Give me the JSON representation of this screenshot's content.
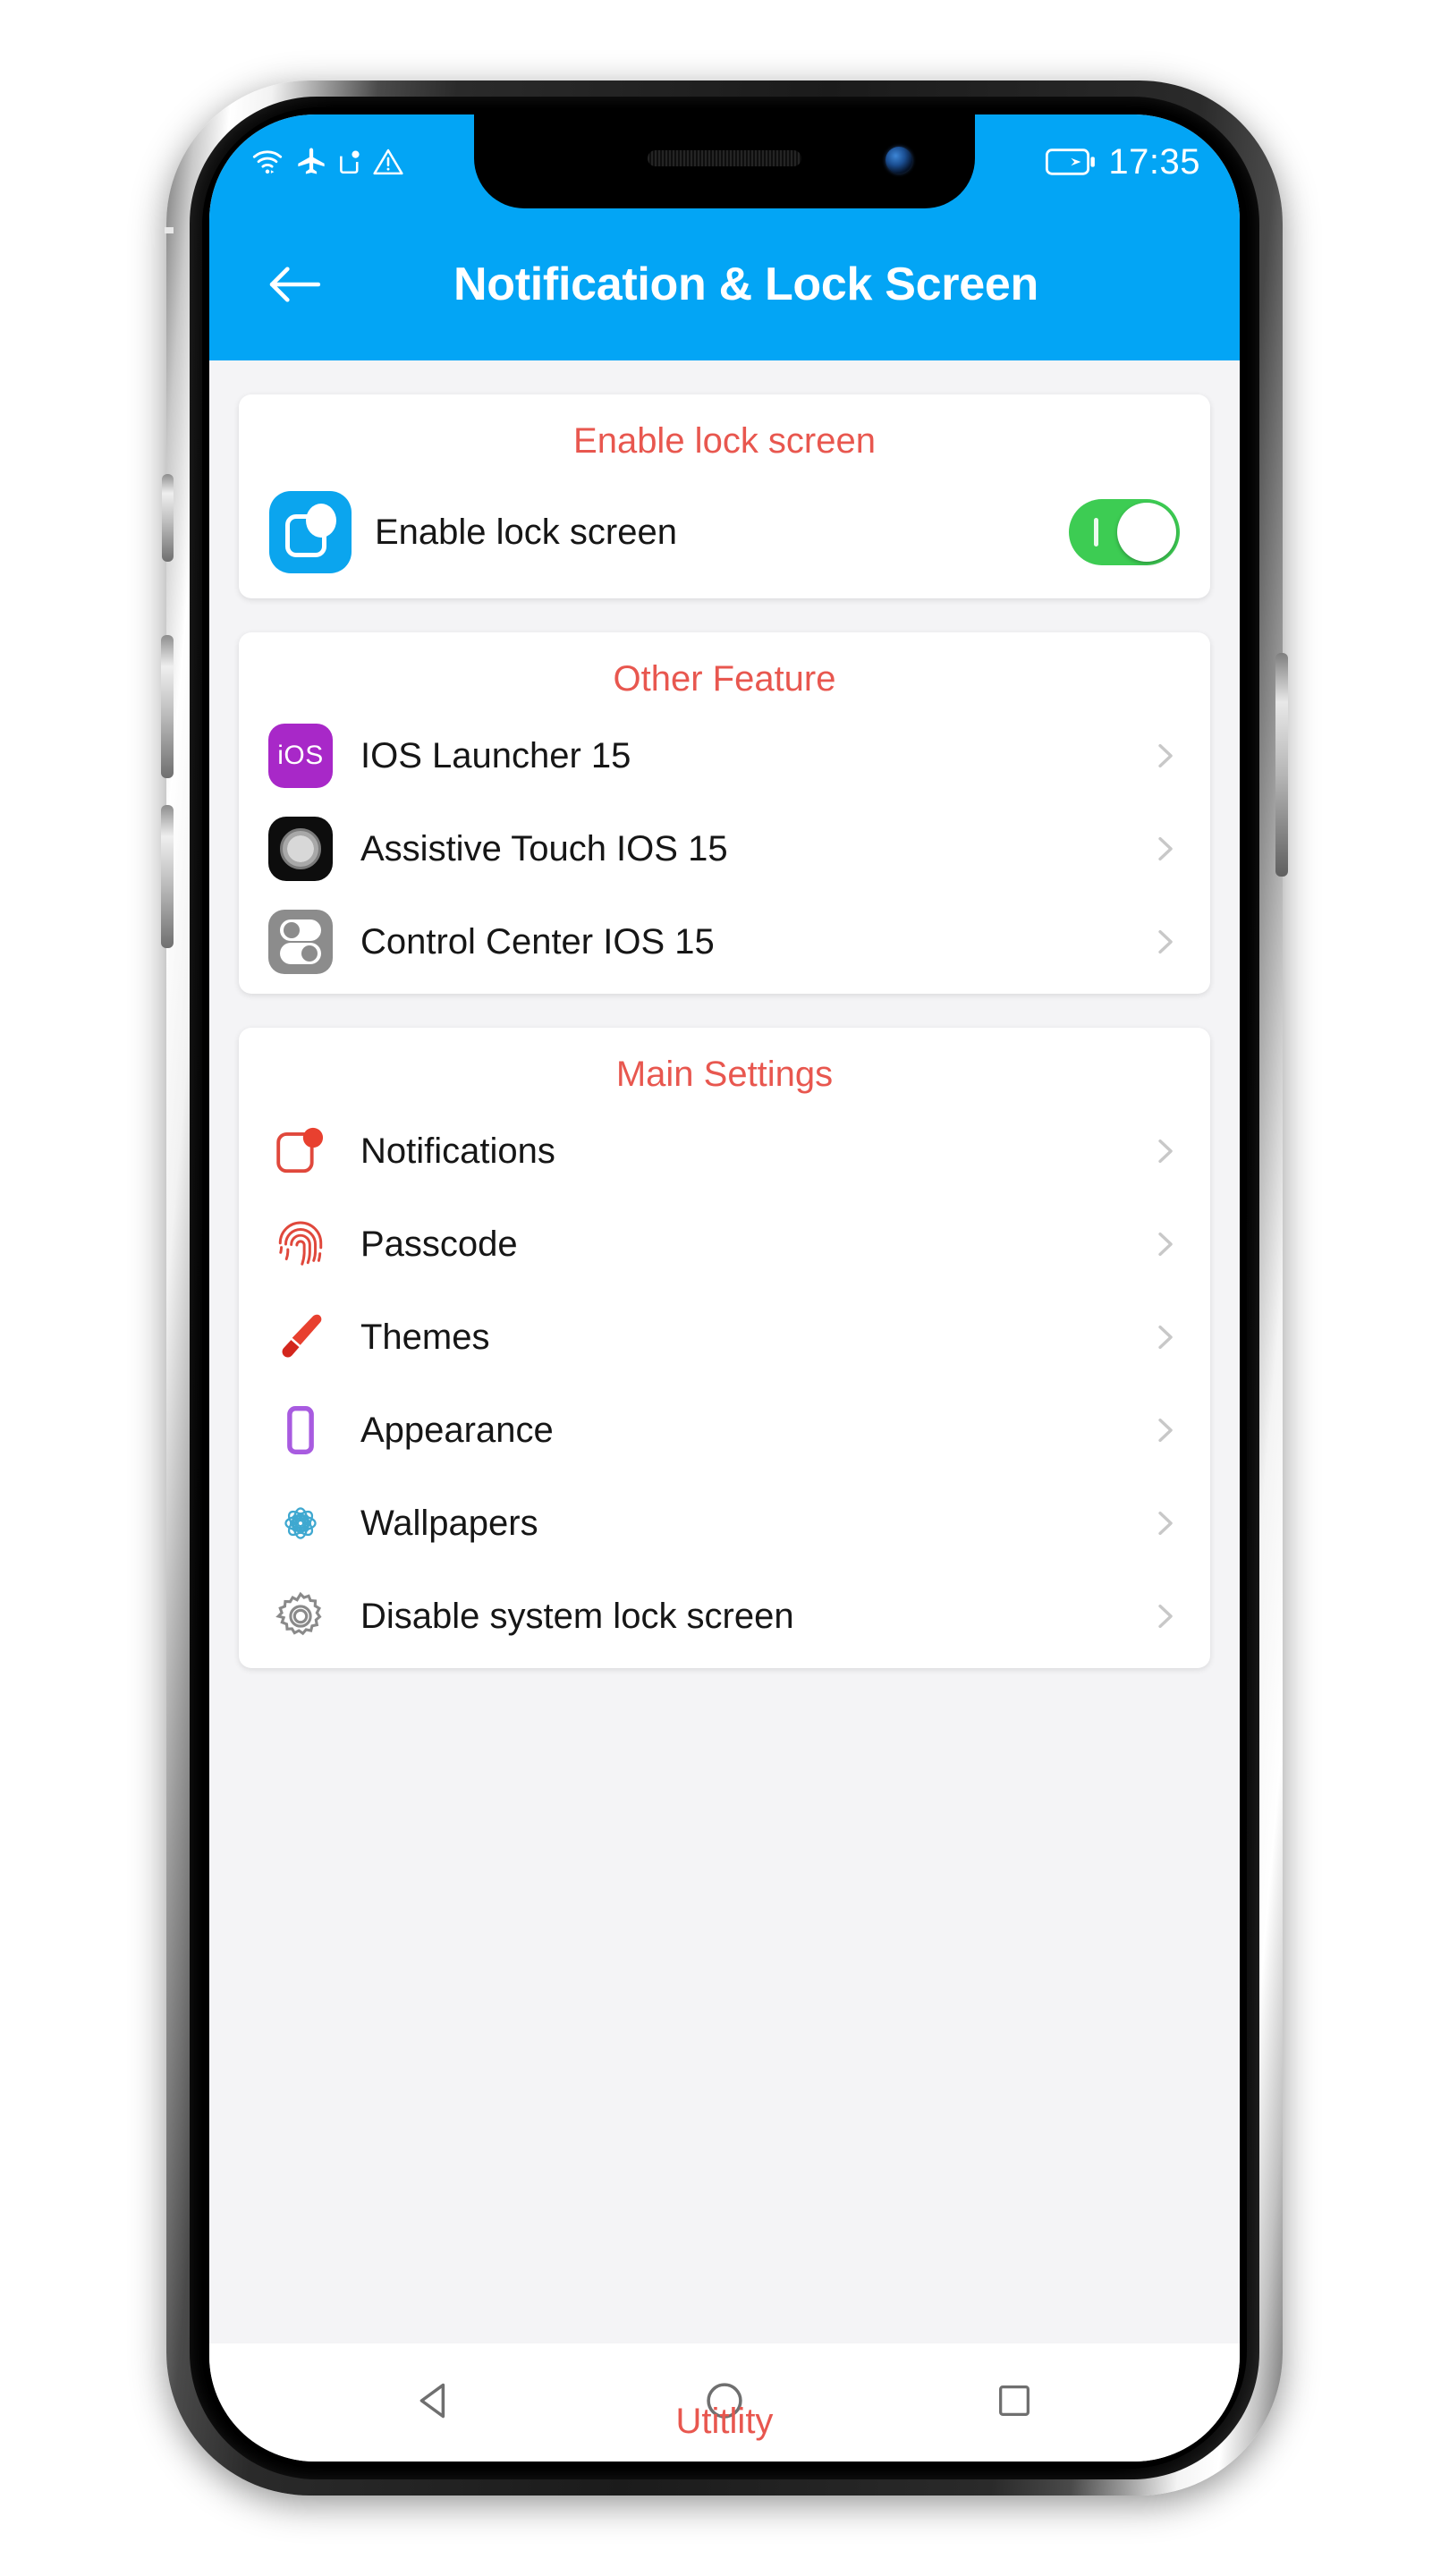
{
  "statusbar": {
    "time": "17:35",
    "icons_left": [
      "wifi-icon",
      "airplane-mode-icon",
      "sim-icon",
      "warning-triangle-icon"
    ],
    "battery": "battery-charging-icon"
  },
  "appbar": {
    "back": "back-arrow-icon",
    "title": "Notification & Lock Screen"
  },
  "colors": {
    "accent_blue": "#03A5F5",
    "section_red": "#E8574F",
    "toggle_green": "#3DCC53",
    "chevron_gray": "#C8C8C8",
    "page_bg": "#F4F4F6",
    "card_bg": "#FFFFFF"
  },
  "cards": [
    {
      "title": "Enable lock screen",
      "rows": [
        {
          "label": "Enable lock screen",
          "icon": "lock-screen-app-icon",
          "control": "toggle",
          "toggle_on": true
        }
      ]
    },
    {
      "title": "Other Feature",
      "rows": [
        {
          "label": "IOS Launcher 15",
          "icon": "ios-launcher-icon",
          "icon_text": "iOS",
          "control": "chevron"
        },
        {
          "label": "Assistive Touch IOS 15",
          "icon": "assistive-touch-icon",
          "control": "chevron"
        },
        {
          "label": "Control Center IOS 15",
          "icon": "control-center-icon",
          "control": "chevron"
        }
      ]
    },
    {
      "title": "Main Settings",
      "rows": [
        {
          "label": "Notifications",
          "icon": "notification-badge-icon",
          "control": "chevron"
        },
        {
          "label": "Passcode",
          "icon": "fingerprint-icon",
          "control": "chevron"
        },
        {
          "label": "Themes",
          "icon": "paintbrush-icon",
          "control": "chevron"
        },
        {
          "label": "Appearance",
          "icon": "phone-outline-icon",
          "control": "chevron"
        },
        {
          "label": "Wallpapers",
          "icon": "flower-mandala-icon",
          "control": "chevron"
        },
        {
          "label": "Disable system lock screen",
          "icon": "gear-icon",
          "control": "chevron"
        }
      ]
    }
  ],
  "navbar": {
    "back": "nav-back-triangle-icon",
    "home": "nav-home-circle-icon",
    "recents": "nav-recents-square-icon",
    "overlay_label": "Utitlity"
  }
}
